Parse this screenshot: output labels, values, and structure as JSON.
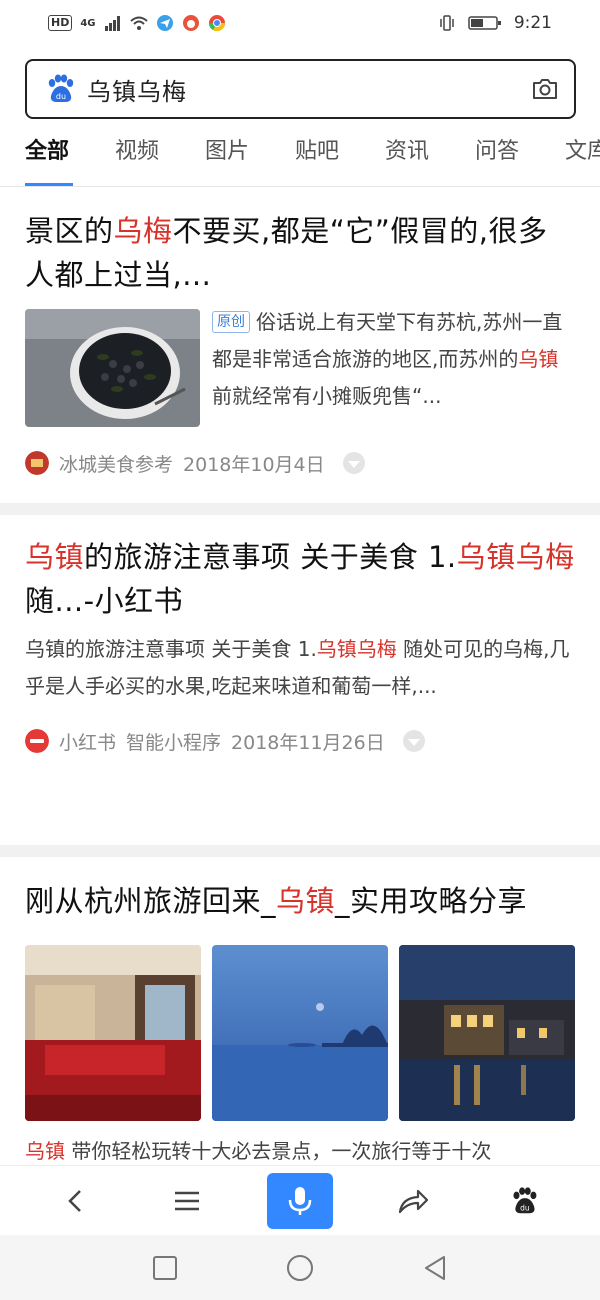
{
  "status_bar": {
    "hd": "HD",
    "network": "4G",
    "time": "9:21"
  },
  "search": {
    "query": "乌镇乌梅"
  },
  "tabs": [
    {
      "label": "全部",
      "active": true
    },
    {
      "label": "视频"
    },
    {
      "label": "图片"
    },
    {
      "label": "贴吧"
    },
    {
      "label": "资讯"
    },
    {
      "label": "问答"
    },
    {
      "label": "文库"
    }
  ],
  "results": [
    {
      "title_parts": [
        "景区的",
        "乌梅",
        "不要买,都是“它”假冒的,很多人都上过当,..."
      ],
      "badge": "原创",
      "snippet_parts": [
        "俗话说上有天堂下有苏杭,苏州一直都是非常适合旅游的地区,而苏州的",
        "乌镇",
        "前就经常有小摊贩兜售“..."
      ],
      "source": "冰城美食参考",
      "date": "2018年10月4日"
    },
    {
      "title_parts": [
        "乌镇",
        "的旅游注意事项 关于美食 1.",
        "乌镇乌梅",
        " 随...-小红书"
      ],
      "snippet_parts": [
        "乌镇的旅游注意事项 关于美食 1.",
        "乌镇乌梅",
        " 随处可见的乌梅,几乎是人手必买的水果,吃起来味道和葡萄一样,..."
      ],
      "source": "小红书",
      "source_tag": "智能小程序",
      "date": "2018年11月26日"
    },
    {
      "title_parts": [
        "刚从杭州旅游回来_",
        "乌镇",
        "_实用攻略分享"
      ],
      "snippet_parts": [
        "乌镇",
        " 带你轻松玩转十大必去景点，一次旅行等于十次"
      ]
    }
  ],
  "colors": {
    "accent": "#3388ff",
    "highlight": "#d8332b"
  }
}
